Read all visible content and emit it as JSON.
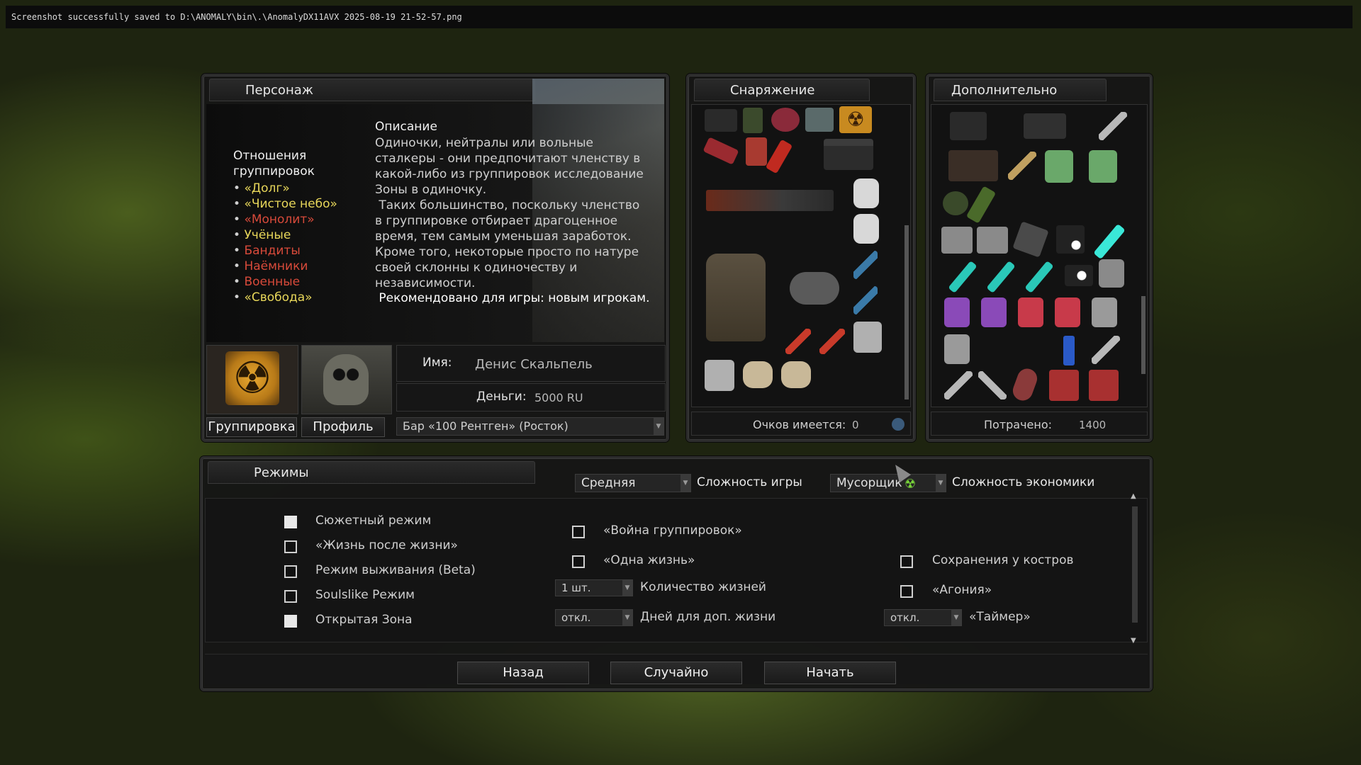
{
  "console": {
    "text": "Screenshot successfully saved to D:\\ANOMALY\\bin\\.\\AnomalyDX11AVX 2025-08-19 21-52-57.png"
  },
  "character": {
    "tab": "Персонаж",
    "relations_title": "Отношения группировок",
    "factions": [
      {
        "name": "«Долг»",
        "color": "#e8d75a"
      },
      {
        "name": "«Чистое небо»",
        "color": "#e8d75a"
      },
      {
        "name": "«Монолит»",
        "color": "#d84a3a"
      },
      {
        "name": "Учёные",
        "color": "#e8d75a"
      },
      {
        "name": "Бандиты",
        "color": "#d84a3a"
      },
      {
        "name": "Наёмники",
        "color": "#d84a3a"
      },
      {
        "name": "Военные",
        "color": "#d84a3a"
      },
      {
        "name": "«Свобода»",
        "color": "#e8d75a"
      }
    ],
    "description_title": "Описание",
    "description_lines": [
      "Одиночки, нейтралы или вольные",
      "сталкеры - они предпочитают членству в",
      "какой-либо из группировок исследование",
      "Зоны в одиночку.",
      " Таких большинство, поскольку членство",
      "в группировке отбирает драгоценное",
      "время, тем самым уменьшая заработок.",
      "Кроме того, некоторые просто по натуре",
      "своей склонны к одиночеству и",
      "независимости."
    ],
    "recommended": " Рекомендовано для игры: новым игрокам.",
    "name_label": "Имя:",
    "name_value": "Денис Скальпель",
    "money_label": "Деньги:",
    "money_value": "5000 RU",
    "faction_button": "Группировка",
    "profile_button": "Профиль",
    "location": "Бар «100 Рентген» (Росток)"
  },
  "equipment": {
    "tab": "Снаряжение",
    "points_label": "Очков имеется:",
    "points_value": "0"
  },
  "additional": {
    "tab": "Дополнительно",
    "spent_label": "Потрачено:",
    "spent_value": "1400"
  },
  "modes": {
    "tab": "Режимы",
    "game_difficulty_value": "Средняя",
    "game_difficulty_label": "Сложность игры",
    "economy_difficulty_value": "Мусорщик",
    "economy_difficulty_label": "Сложность экономики",
    "story_mode": "Сюжетный режим",
    "afterlife": "«Жизнь после жизни»",
    "survival": "Режим выживания (Beta)",
    "soulslike": "Soulslike Режим",
    "open_zone": "Открытая Зона",
    "faction_war": "«Война группировок»",
    "one_life": "«Одна жизнь»",
    "lives_value": "1 шт.",
    "lives_label": "Количество жизней",
    "days_value": "откл.",
    "days_label": "Дней для доп. жизни",
    "campfire_saves": "Сохранения у костров",
    "agony": "«Агония»",
    "timer_value": "откл.",
    "timer_label": "«Таймер»"
  },
  "buttons": {
    "back": "Назад",
    "random": "Случайно",
    "start": "Начать"
  }
}
